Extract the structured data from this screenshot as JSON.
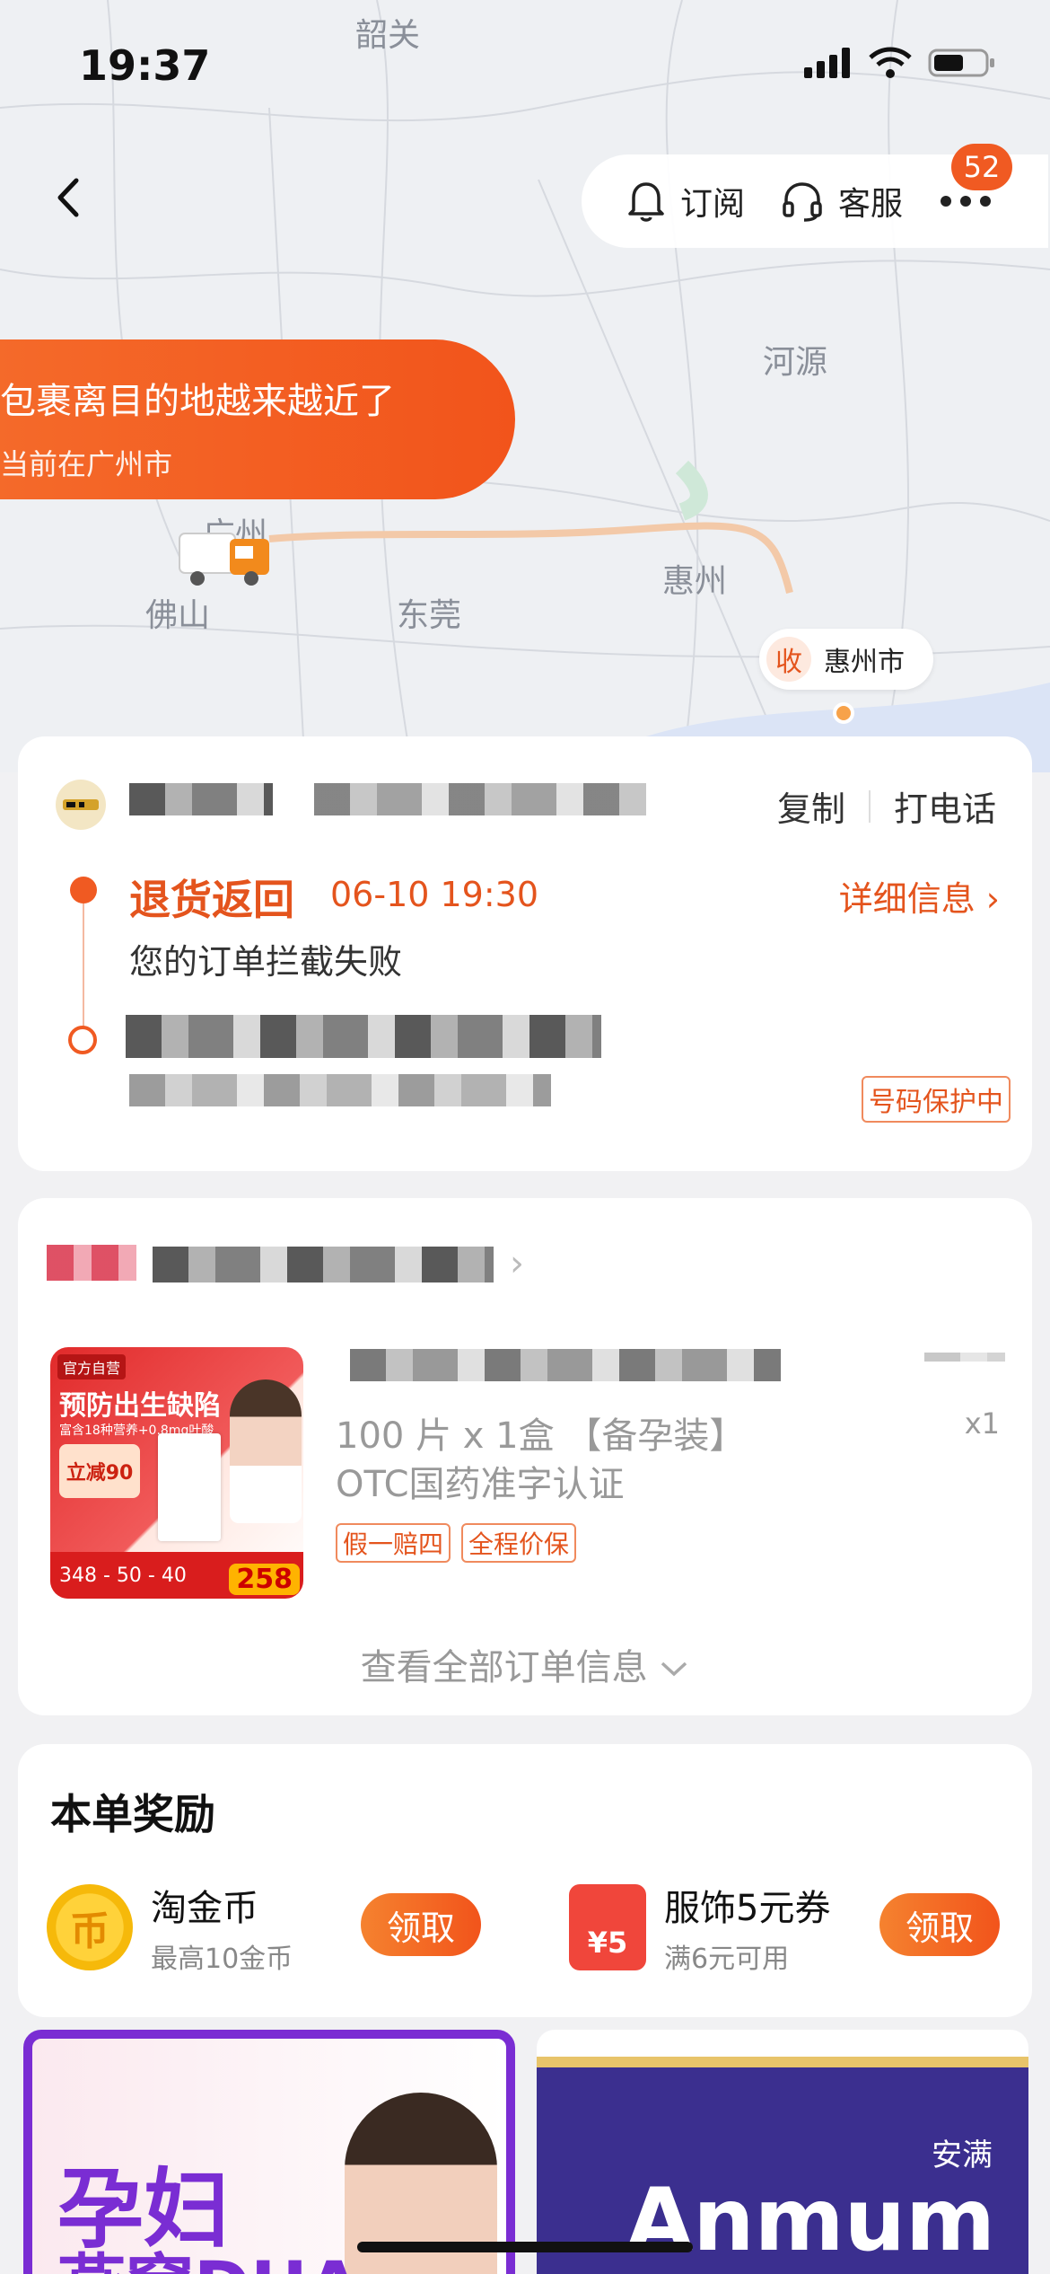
{
  "status_bar": {
    "time": "19:37"
  },
  "header": {
    "subscribe_label": "订阅",
    "service_label": "客服",
    "badge_count": "52"
  },
  "map": {
    "bubble_line1": "包裹离目的地越来越近了",
    "bubble_line2": "当前在广州市",
    "cities": {
      "shaoguan": "韶关",
      "heyuan": "河源",
      "guangzhou": "广州",
      "foshan": "佛山",
      "dongguan": "东莞",
      "huizhou": "惠州"
    },
    "dest_tag": "收",
    "dest_city": "惠州市"
  },
  "logistics": {
    "copy_label": "复制",
    "call_label": "打电话",
    "status_title": "退货返回",
    "status_time": "06-10 19:30",
    "detail_label": "详细信息 ›",
    "status_desc": "您的订单拦截失败",
    "protect_label": "号码保护中",
    "accent_color": "#e4541d"
  },
  "order": {
    "product_spec_line1": "100 片 x 1盒 【备孕装】",
    "product_spec_line2": "OTC国药准字认证",
    "quantity": "x1",
    "chips": [
      "假一赔四",
      "全程价保"
    ],
    "see_all_label": "查看全部订单信息",
    "image": {
      "tag": "官方自营",
      "headline": "预防出生缺陷",
      "sub": "富含18种营养+0.8mg叶酸",
      "promo": "立减90",
      "prices": "348 - 50 - 40",
      "final_price": "258"
    }
  },
  "rewards": {
    "title": "本单奖励",
    "items": [
      {
        "name": "淘金币",
        "desc": "最高10金币",
        "button": "领取",
        "icon": "币"
      },
      {
        "name": "服饰5元券",
        "desc": "满6元可用",
        "button": "领取",
        "icon": "¥5"
      }
    ]
  },
  "ads": {
    "left_line1": "孕妇",
    "left_line2": "燕窝DHA",
    "right_brand": "Anmum",
    "right_cn": "安满"
  }
}
